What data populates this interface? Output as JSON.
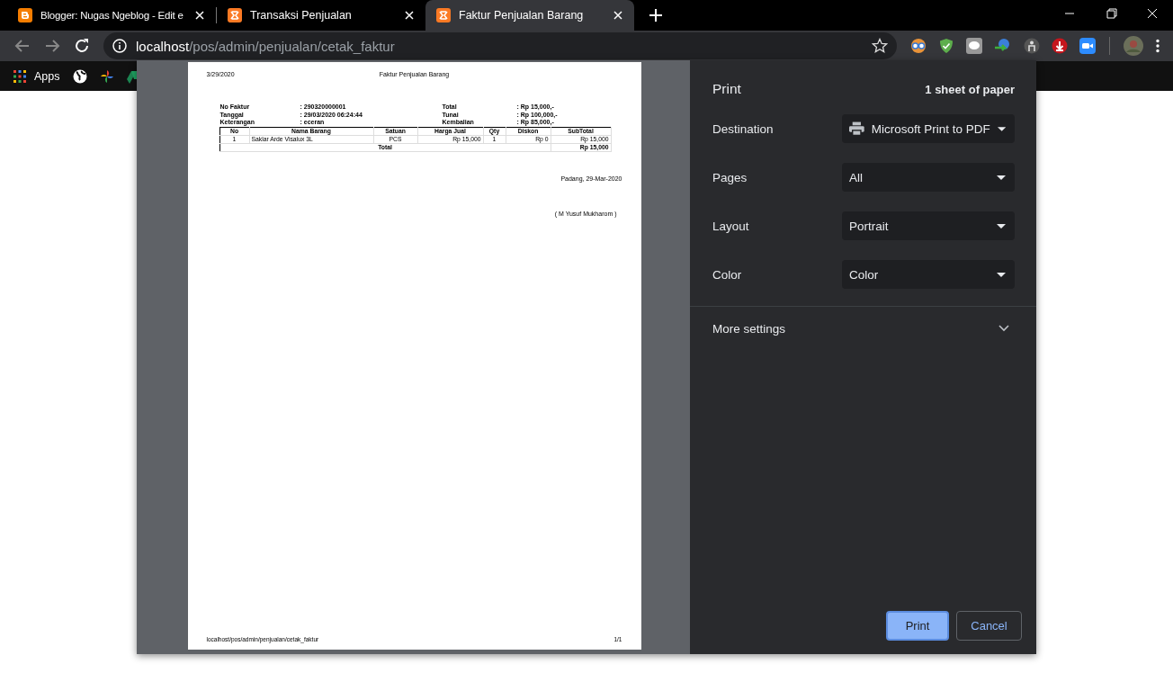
{
  "tabs": [
    {
      "title": "Blogger: Nugas Ngeblog - Edit e",
      "selected": false
    },
    {
      "title": "Transaksi Penjualan",
      "selected": false
    },
    {
      "title": "Faktur Penjualan Barang",
      "selected": true
    }
  ],
  "address": {
    "host": "localhost",
    "path": "/pos/admin/penjualan/cetak_faktur"
  },
  "bookmarks": [
    {
      "label": "Apps"
    }
  ],
  "preview": {
    "date": "3/29/2020",
    "title": "Faktur Penjualan Barang",
    "info": [
      {
        "label": "No Faktur",
        "value": ": 290320000001",
        "label2": "Total",
        "value2": ": Rp 15,000,-"
      },
      {
        "label": "Tanggal",
        "value": ": 29/03/2020 06:24:44",
        "label2": "Tunai",
        "value2": ": Rp 100,000,-"
      },
      {
        "label": "Keterangan",
        "value": ": eceran",
        "label2": "Kembalian",
        "value2": ": Rp 85,000,-"
      }
    ],
    "columns": [
      "No",
      "Nama Barang",
      "Satuan",
      "Harga Jual",
      "Qty",
      "Diskon",
      "SubTotal"
    ],
    "rows": [
      [
        "1",
        "Saklar Arde Visalux 3L",
        "PCS",
        "Rp 15,000",
        "1",
        "Rp 0",
        "Rp 15,000"
      ]
    ],
    "total_label": "Total",
    "total_value": "Rp 15,000",
    "place_date": "Padang, 29-Mar-2020",
    "signature": "( M Yusuf Mukharom )",
    "footer_url": "localhost/pos/admin/penjualan/cetak_faktur",
    "page_number": "1/1"
  },
  "print": {
    "title": "Print",
    "sheets": "1 sheet of paper",
    "settings": [
      {
        "label": "Destination",
        "value": "Microsoft Print to PDF",
        "kind": "printer"
      },
      {
        "label": "Pages",
        "value": "All",
        "kind": "plain"
      },
      {
        "label": "Layout",
        "value": "Portrait",
        "kind": "plain"
      },
      {
        "label": "Color",
        "value": "Color",
        "kind": "plain"
      }
    ],
    "more_settings": {
      "label": "More settings",
      "expanded": false
    },
    "buttons": [
      {
        "label": "Print",
        "kind": "primary"
      },
      {
        "label": "Cancel",
        "kind": "secondary"
      }
    ]
  }
}
